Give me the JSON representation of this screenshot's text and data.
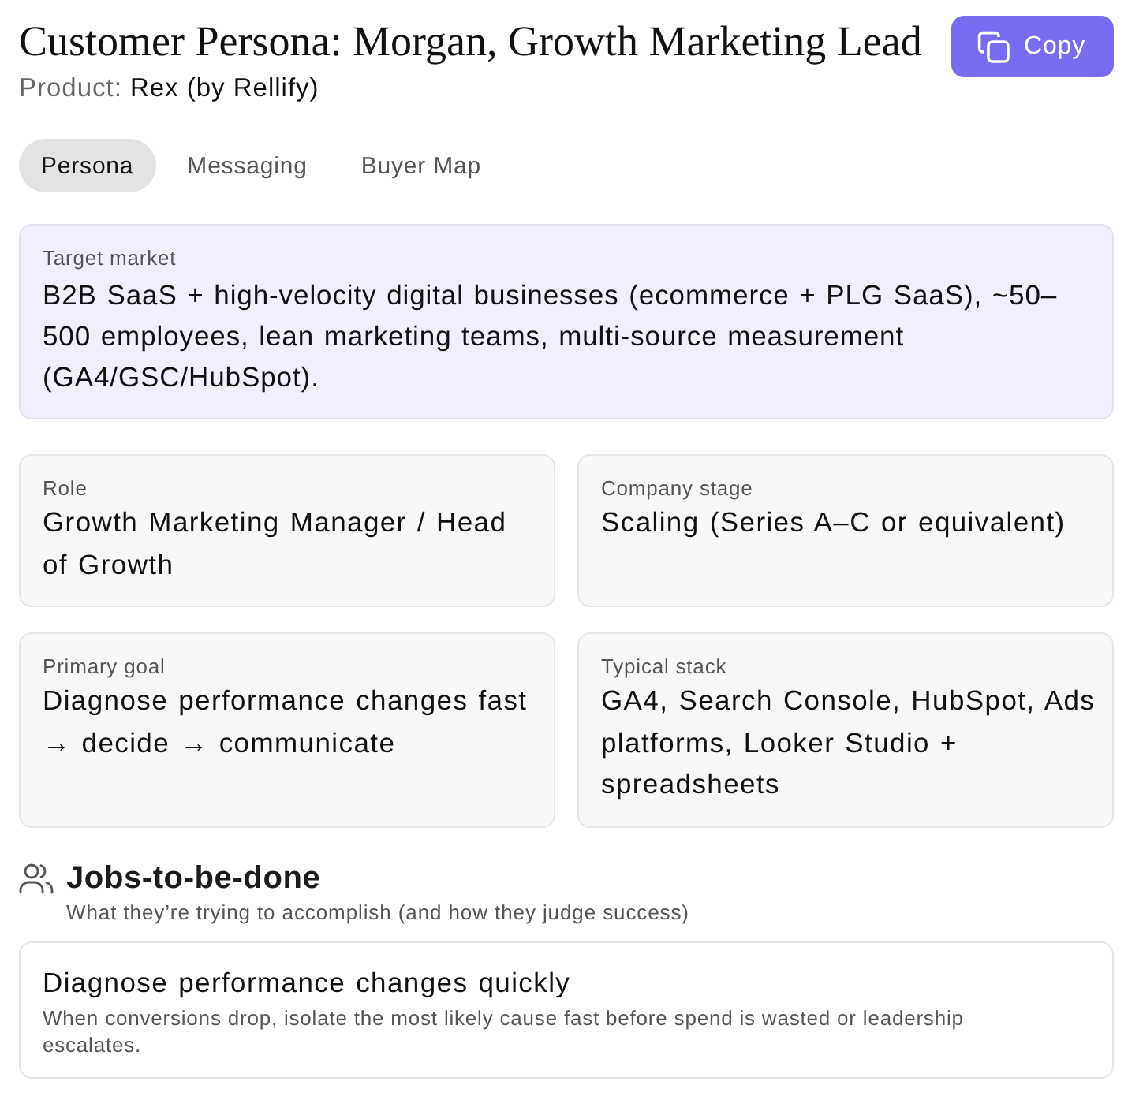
{
  "header": {
    "title": "Customer Persona: Morgan, Growth Marketing Lead",
    "product_label": "Product:",
    "product_name": "Rex (by Rellify)",
    "copy_button": "Copy"
  },
  "tabs": [
    {
      "label": "Persona",
      "selected": true
    },
    {
      "label": "Messaging",
      "selected": false
    },
    {
      "label": "Buyer Map",
      "selected": false
    }
  ],
  "target_market": {
    "label": "Target market",
    "text": "B2B SaaS + high-velocity digital businesses (ecommerce + PLG SaaS), ~50–500 employees, lean marketing teams, multi-source measurement (GA4/GSC/HubSpot)."
  },
  "facts": [
    {
      "label": "Role",
      "value": "Growth Marketing Manager / Head of Growth"
    },
    {
      "label": "Company stage",
      "value": "Scaling (Series A–C or equivalent)"
    },
    {
      "label": "Primary goal",
      "value": "Diagnose performance changes fast → decide → communicate"
    },
    {
      "label": "Typical stack",
      "value": "GA4, Search Console, HubSpot, Ads platforms, Looker Studio + spreadsheets"
    }
  ],
  "jobs": {
    "title": "Jobs-to-be-done",
    "subtitle": "What they’re trying to accomplish (and how they judge success)",
    "items": [
      {
        "title": "Diagnose performance changes quickly",
        "description": "When conversions drop, isolate the most likely cause fast before spend is wasted or leadership escalates."
      }
    ]
  }
}
